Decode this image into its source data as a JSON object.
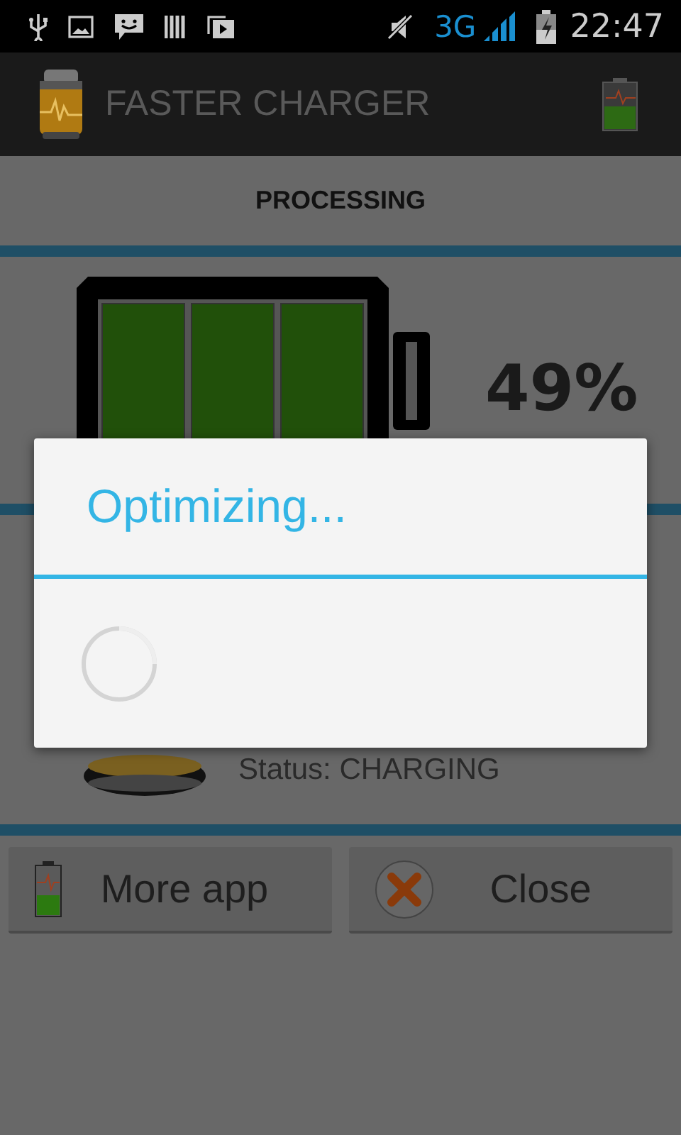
{
  "status_bar": {
    "network": "3G",
    "time": "22:47"
  },
  "app_bar": {
    "title": "FASTER CHARGER"
  },
  "header": "PROCESSING",
  "battery": {
    "percent": "49%"
  },
  "charger": {
    "status": "Status: CHARGING"
  },
  "buttons": [
    {
      "label": "More app",
      "kind": "more"
    },
    {
      "label": "Close",
      "kind": "close"
    }
  ],
  "dialog": {
    "title": "Optimizing..."
  }
}
